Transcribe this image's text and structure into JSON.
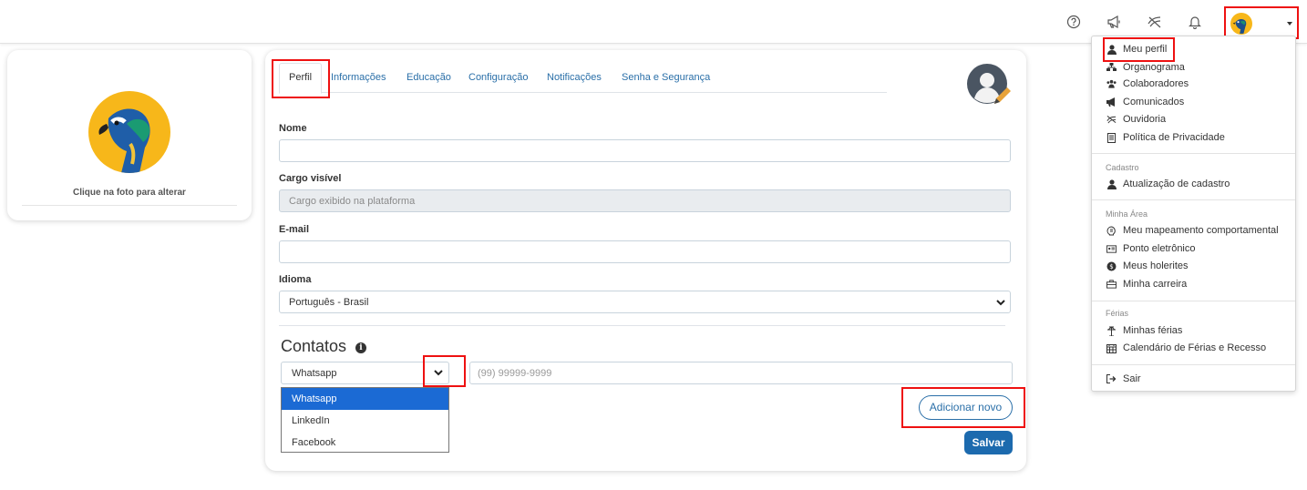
{
  "colors": {
    "accent": "#2a6fa8",
    "primary_button": "#1c6aae",
    "selected_option": "#1b6ad4",
    "highlight_box": "#ee1111"
  },
  "topbar": {
    "icons": [
      "help-icon",
      "megaphone-icon",
      "ombudsman-icon",
      "bell-icon"
    ]
  },
  "left_card": {
    "caption": "Clique na foto para alterar"
  },
  "tabs": [
    {
      "label": "Perfil",
      "active": true
    },
    {
      "label": "Informações"
    },
    {
      "label": "Educação"
    },
    {
      "label": "Configuração"
    },
    {
      "label": "Notificações"
    },
    {
      "label": "Senha e Segurança"
    }
  ],
  "form": {
    "nome": {
      "label": "Nome",
      "value": ""
    },
    "cargo": {
      "label": "Cargo visível",
      "placeholder": "Cargo exibido na plataforma"
    },
    "email": {
      "label": "E-mail",
      "value": ""
    },
    "idioma": {
      "label": "Idioma",
      "value": "Português - Brasil"
    }
  },
  "contatos": {
    "title": "Contatos",
    "type_value": "Whatsapp",
    "phone_placeholder": "(99) 99999-9999",
    "options": [
      "Whatsapp",
      "LinkedIn",
      "Facebook"
    ],
    "add_label": "Adicionar novo",
    "save_label": "Salvar"
  },
  "user_menu": {
    "items_top": [
      {
        "label": "Meu perfil",
        "icon": "user-icon"
      },
      {
        "label": "Organograma",
        "icon": "org-chart-icon"
      },
      {
        "label": "Colaboradores",
        "icon": "users-icon"
      },
      {
        "label": "Comunicados",
        "icon": "megaphone-icon"
      },
      {
        "label": "Ouvidoria",
        "icon": "ombudsman-icon"
      },
      {
        "label": "Política de Privacidade",
        "icon": "document-icon"
      }
    ],
    "section_cadastro": {
      "title": "Cadastro",
      "items": [
        {
          "label": "Atualização de cadastro",
          "icon": "user-icon"
        }
      ]
    },
    "section_minha_area": {
      "title": "Minha Área",
      "items": [
        {
          "label": "Meu mapeamento comportamental",
          "icon": "brain-icon"
        },
        {
          "label": "Ponto eletrônico",
          "icon": "id-card-icon"
        },
        {
          "label": "Meus holerites",
          "icon": "money-icon"
        },
        {
          "label": "Minha carreira",
          "icon": "briefcase-icon"
        }
      ]
    },
    "section_ferias": {
      "title": "Férias",
      "items": [
        {
          "label": "Minhas férias",
          "icon": "umbrella-icon"
        },
        {
          "label": "Calendário de Férias e Recesso",
          "icon": "calendar-icon"
        }
      ]
    },
    "logout": {
      "label": "Sair",
      "icon": "logout-icon"
    }
  }
}
